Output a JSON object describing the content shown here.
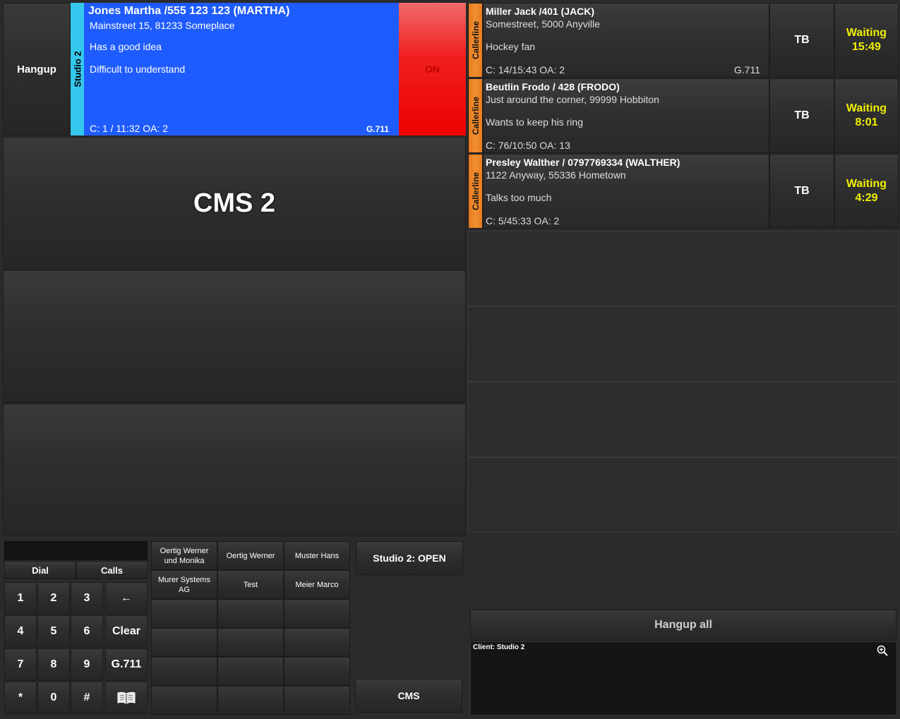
{
  "active_call": {
    "hangup_label": "Hangup",
    "studio_label": "Studio 2",
    "caller": "Jones Martha /555 123 123 (MARTHA)",
    "address": "Mainstreet 15, 81233 Someplace",
    "note1": "Has a good idea",
    "note2": "Difficult to understand",
    "stats": "C: 1 / 11:32  OA: 2",
    "codec": "G.711",
    "on_label": "ON",
    "strip_color": "#35c8ee",
    "info_color": "#1f5cff"
  },
  "cms_title": "CMS 2",
  "waiting_calls": [
    {
      "line_label": "Callerline",
      "caller": "Miller Jack /401 (JACK)",
      "address": "Somestreet, 5000 Anyville",
      "note": "Hockey fan",
      "stats": "C: 14/15:43  OA: 2",
      "codec": "G.711",
      "tb_label": "TB",
      "status": "Waiting",
      "time": "15:49"
    },
    {
      "line_label": "Callerline",
      "caller": "Beutlin Frodo / 428 (FRODO)",
      "address": "Just around the corner, 99999 Hobbiton",
      "note": "Wants to keep his ring",
      "stats": "C: 76/10:50  OA: 13",
      "codec": "",
      "tb_label": "TB",
      "status": "Waiting",
      "time": "8:01"
    },
    {
      "line_label": "Callerline",
      "caller": "Presley Walther / 0797769334 (WALTHER)",
      "address": "1122 Anyway, 55336 Hometown",
      "note": "Talks too much",
      "stats": "C: 5/45:33  OA: 2",
      "codec": "",
      "tb_label": "TB",
      "status": "Waiting",
      "time": "4:29"
    }
  ],
  "dialer": {
    "display_value": "",
    "tab_dial": "Dial",
    "tab_calls": "Calls",
    "keys": [
      "1",
      "2",
      "3",
      "←",
      "4",
      "5",
      "6",
      "Clear",
      "7",
      "8",
      "9",
      "G.711",
      "*",
      "0",
      "#"
    ],
    "phonebook_icon": "book-icon"
  },
  "speed_dial": [
    "Oertig Werner und Monika",
    "Oertig Werner",
    "Muster Hans",
    "Murer Systems AG",
    "Test",
    "Meier Marco"
  ],
  "studio_status": "Studio 2: OPEN",
  "cms_button": "CMS",
  "hangup_all": "Hangup all",
  "log": {
    "client_label": "Client:",
    "client_value": "Studio 2",
    "zoom_icon": "zoom-in-icon"
  },
  "colors": {
    "on_red": "#ee0000",
    "callerline_orange": "#f09030",
    "waiting_yellow": "#f0f000"
  }
}
